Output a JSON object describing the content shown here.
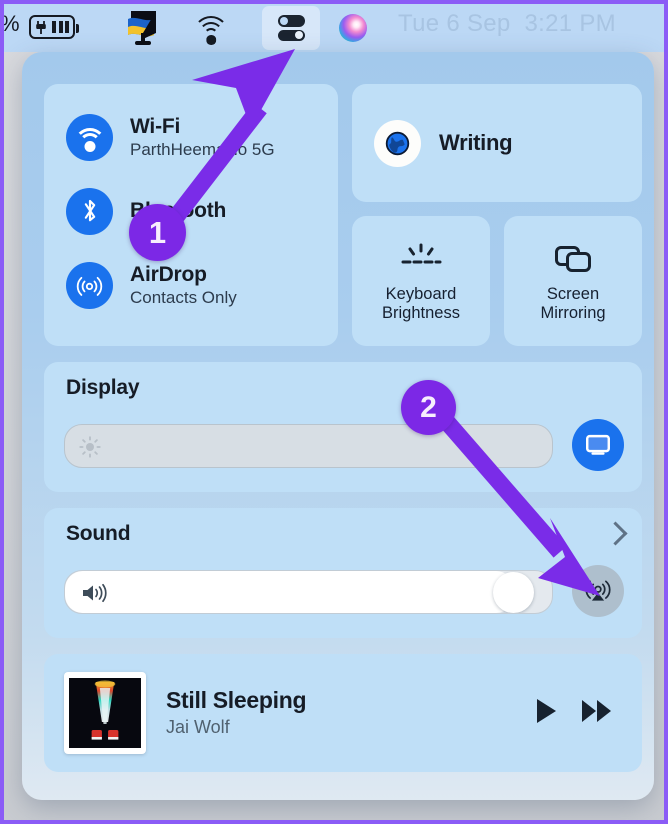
{
  "menubar": {
    "battery_percent_fragment": "%",
    "battery_icon": "battery-charging-icon",
    "flag_icon": "ukraine-flag-display-icon",
    "wifi_icon": "wifi-icon",
    "control_center_icon": "control-center-toggles-icon",
    "siri_icon": "siri-orb-icon",
    "clock": "Tue 6 Sep  3:21 PM"
  },
  "control_center": {
    "connectivity": {
      "items": [
        {
          "label": "Wi-Fi",
          "sublabel": "ParthHeemaJio 5G",
          "icon": "wifi-icon",
          "active": true
        },
        {
          "label": "Bluetooth",
          "sublabel": "",
          "icon": "bluetooth-icon",
          "active": true
        },
        {
          "label": "AirDrop",
          "sublabel": "Contacts Only",
          "icon": "airdrop-icon",
          "active": true
        }
      ],
      "active_color": "#1a72ed"
    },
    "focus": {
      "label": "Writing",
      "icon": "globe-focus-icon"
    },
    "tiles": [
      {
        "label": "Keyboard\nBrightness",
        "line1": "Keyboard",
        "line2": "Brightness",
        "icon": "keyboard-brightness-icon"
      },
      {
        "label": "Screen\nMirroring",
        "line1": "Screen",
        "line2": "Mirroring",
        "icon": "screen-mirroring-icon"
      }
    ],
    "display": {
      "title": "Display",
      "slider_icon": "brightness-sun-icon",
      "slider_value_percent": 0,
      "airplay_button_icon": "display-monitor-icon",
      "airplay_button_color": "#1a72ed"
    },
    "sound": {
      "title": "Sound",
      "slider_icon": "speaker-volume-icon",
      "slider_value_percent": 96,
      "chevron_icon": "chevron-right-icon",
      "output_button_icon": "airplay-audio-icon",
      "output_button_color": "#aebfcd"
    },
    "now_playing": {
      "title": "Still Sleeping",
      "artist": "Jai Wolf",
      "album_art": "album-artwork-jai-wolf",
      "play_icon": "play-icon",
      "next_icon": "fast-forward-icon"
    }
  },
  "annotations": {
    "badges": [
      {
        "number": "1",
        "color": "#7c28e6"
      },
      {
        "number": "2",
        "color": "#7c28e6"
      }
    ],
    "arrow_color": "#7a2ce8"
  }
}
